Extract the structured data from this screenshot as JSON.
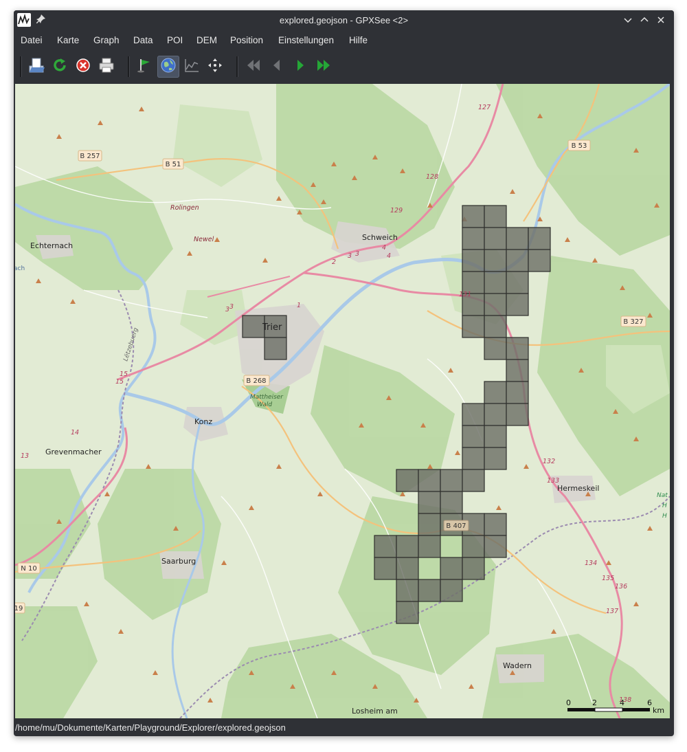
{
  "window": {
    "title": "explored.geojson - GPXSee <2>"
  },
  "menu": [
    "Datei",
    "Karte",
    "Graph",
    "Data",
    "POI",
    "DEM",
    "Position",
    "Einstellungen",
    "Hilfe"
  ],
  "toolbar": {
    "buttons": [
      {
        "name": "open-icon"
      },
      {
        "name": "reload-icon"
      },
      {
        "name": "close-file-icon"
      },
      {
        "name": "print-icon"
      },
      {
        "name": "waypoints-flag-icon"
      },
      {
        "name": "map-globe-icon",
        "active": true
      },
      {
        "name": "graph-icon"
      },
      {
        "name": "move-pan-icon"
      },
      {
        "name": "first-icon"
      },
      {
        "name": "previous-icon"
      },
      {
        "name": "next-icon"
      },
      {
        "name": "last-icon"
      }
    ]
  },
  "map": {
    "places": {
      "echternach": "Echternach",
      "rolingen": "Rolingen",
      "newel": "Newel",
      "schweich": "Schweich",
      "trier": "Trier",
      "konz": "Konz",
      "grevenmacher": "Grevenmacher",
      "mattheiser": "Mattheiser",
      "wald": "Wald",
      "saarburg": "Saarburg",
      "hermeskeil": "Hermeskeil",
      "wadern": "Wadern",
      "losheim": "Losheim am",
      "letzebuerg": "Lëtzebuerg",
      "nat1": "Nat",
      "nat2": "H",
      "nat3": "H",
      "ach": "ach"
    },
    "roads": {
      "b257": "B 257",
      "b51": "B 51",
      "b53": "B 53",
      "b327": "B 327",
      "b268": "B 268",
      "b407": "B 407",
      "n10": "N 10",
      "n19": "19",
      "r127": "127",
      "r128": "128",
      "r129": "129",
      "r131": "131",
      "r132": "132",
      "r133": "133",
      "r134": "134",
      "r135": "135",
      "r136": "136",
      "r137": "137",
      "r138": "138",
      "r14": "14",
      "r13": "13",
      "r15a": "15",
      "r15b": "15",
      "r3a": "3",
      "r3b": "3",
      "r1": "1",
      "r2": "2",
      "r4a": "4",
      "r4b": "4",
      "r33": "3",
      "r3c": "3"
    },
    "scale": {
      "t0": "0",
      "t2": "2",
      "t4": "4",
      "t6": "6",
      "unit": "km"
    }
  },
  "status": {
    "path": "/home/mu/Dokumente/Karten/Playground/Explorer/explored.geojson"
  }
}
